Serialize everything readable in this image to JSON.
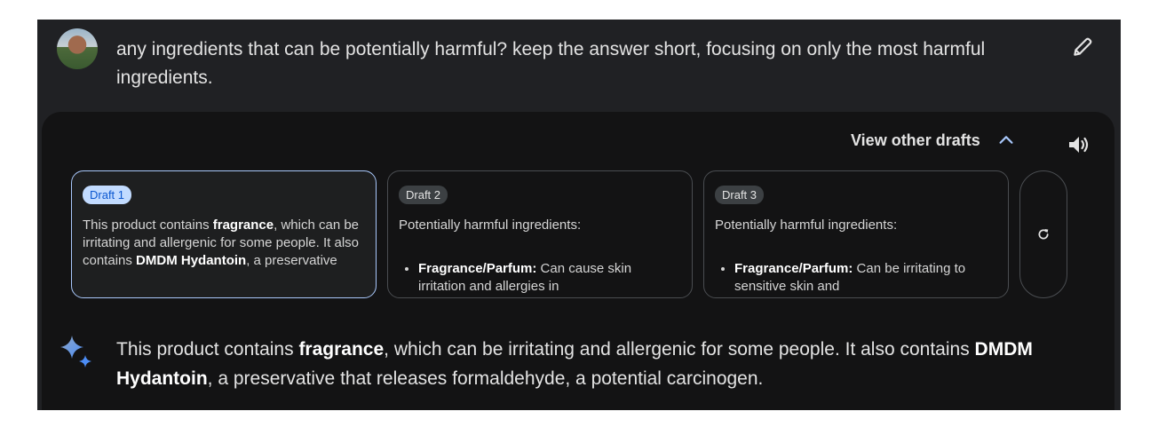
{
  "user_prompt": "any ingredients that can be potentially harmful? keep the answer short, focusing on only the most harmful ingredients.",
  "view_drafts_label": "View other drafts",
  "drafts": [
    {
      "label": "Draft 1",
      "t1": "This product contains ",
      "b1": "fragrance",
      "t2": ", which can be irritating and allergenic for some people. It also contains ",
      "b2": "DMDM Hydantoin",
      "t3": ", a preservative"
    },
    {
      "label": "Draft 2",
      "intro": "Potentially harmful ingredients:",
      "item_bold": "Fragrance/Parfum:",
      "item_text": " Can cause skin irritation and allergies in"
    },
    {
      "label": "Draft 3",
      "intro": "Potentially harmful ingredients:",
      "item_bold": "Fragrance/Parfum:",
      "item_text": " Can be irritating to sensitive skin and"
    }
  ],
  "answer": {
    "t1": "This product contains ",
    "b1": "fragrance",
    "t2": ", which can be irritating and allergenic for some people. It also contains ",
    "b2": "DMDM Hydantoin",
    "t3": ", a preservative that releases formaldehyde, a potential carcinogen."
  },
  "colors": {
    "active_border": "#a8c7fa",
    "active_badge_bg": "#c2dbff",
    "active_badge_text": "#0b57d0",
    "panel_bg": "#131314"
  },
  "icons": {
    "edit": "pencil-icon",
    "collapse": "chevron-up-icon",
    "speaker": "speaker-icon",
    "regenerate": "refresh-icon",
    "assistant": "sparkle-icon"
  }
}
